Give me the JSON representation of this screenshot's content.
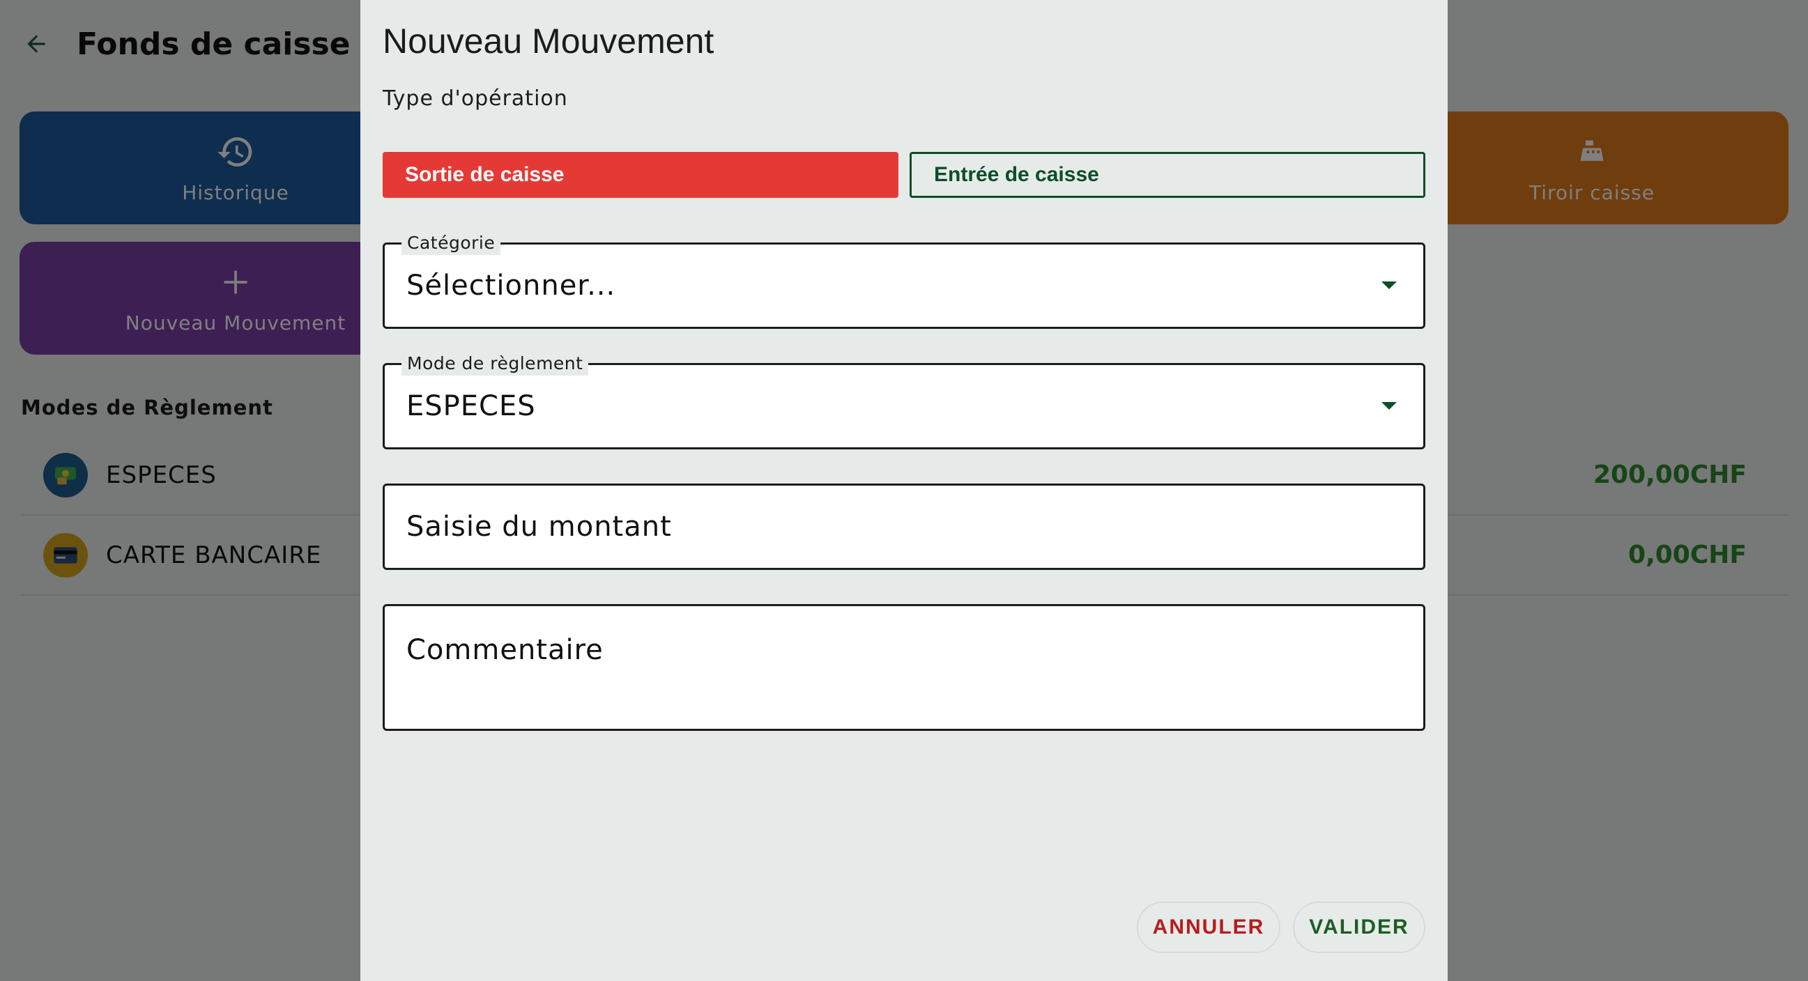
{
  "app": {
    "title": "Fonds de caisse",
    "tiles": {
      "historique": {
        "label": "Historique",
        "icon": "history-icon",
        "color": "#1e5a9c"
      },
      "nouveau": {
        "label": "Nouveau Mouvement",
        "icon": "plus-icon",
        "color": "#7b3fa8"
      },
      "tiroir": {
        "label": "Tiroir caisse",
        "icon": "cash-register-icon",
        "color": "#e07a1c"
      }
    },
    "section_title": "Modes de Règlement",
    "payment_modes": [
      {
        "name": "ESPECES",
        "amount": "200,00CHF",
        "icon": "cash-icon"
      },
      {
        "name": "CARTE BANCAIRE",
        "amount": "0,00CHF",
        "icon": "credit-card-icon"
      }
    ]
  },
  "dialog": {
    "title": "Nouveau Mouvement",
    "subtitle": "Type d'opération",
    "operation_types": {
      "sortie": "Sortie de caisse",
      "entree": "Entrée de caisse",
      "selected": "sortie"
    },
    "categorie": {
      "label": "Catégorie",
      "value": "Sélectionner..."
    },
    "mode_reglement": {
      "label": "Mode de règlement",
      "value": "ESPECES"
    },
    "montant": {
      "placeholder": "Saisie du montant"
    },
    "commentaire": {
      "placeholder": "Commentaire"
    },
    "buttons": {
      "cancel": "ANNULER",
      "confirm": "VALIDER"
    }
  },
  "colors": {
    "accent_red": "#e53935",
    "accent_green": "#0e4d2a",
    "amount_green": "#2f8a2f"
  }
}
